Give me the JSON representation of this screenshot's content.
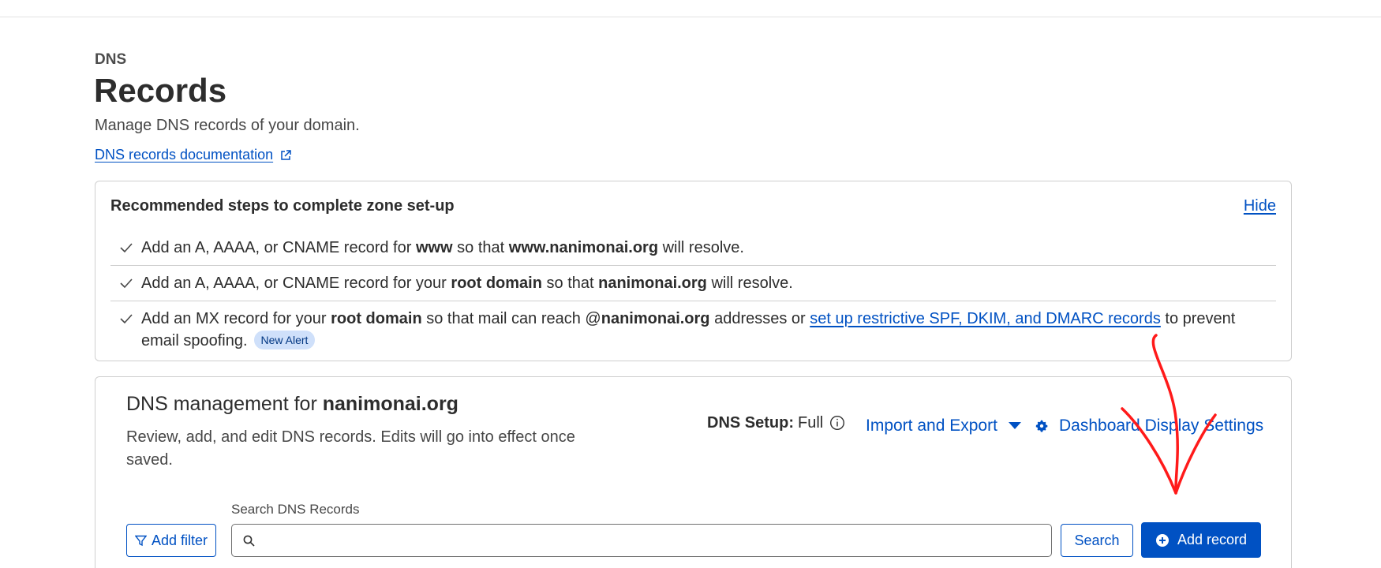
{
  "header": {
    "eyebrow": "DNS",
    "title": "Records",
    "description": "Manage DNS records of your domain.",
    "documentation_link": "DNS records documentation"
  },
  "recommended_steps": {
    "title": "Recommended steps to complete zone set-up",
    "hide_label": "Hide",
    "steps": [
      {
        "text_1": "Add an A, AAAA, or CNAME record for ",
        "bold_1": "www",
        "text_2": " so that ",
        "bold_2": "www.nanimonai.org",
        "text_3": " will resolve."
      },
      {
        "text_1": "Add an A, AAAA, or CNAME record for your ",
        "bold_1": "root domain",
        "text_2": " so that ",
        "bold_2": "nanimonai.org",
        "text_3": " will resolve."
      },
      {
        "text_1": "Add an MX record for your ",
        "bold_1": "root domain",
        "text_2": " so that mail can reach @",
        "bold_2": "nanimonai.org",
        "text_3": " addresses or ",
        "link": "set up restrictive SPF, DKIM, and DMARC records",
        "text_4": " to prevent email spoofing.",
        "badge": "New Alert"
      }
    ]
  },
  "management": {
    "title_prefix": "DNS management for ",
    "domain": "nanimonai.org",
    "description": "Review, add, and edit DNS records. Edits will go into effect once saved.",
    "setup_label": "DNS Setup:",
    "setup_value": "Full",
    "import_export_label": "Import and Export",
    "display_settings_label": "Dashboard Display Settings",
    "search_label": "Search DNS Records",
    "search_value": "",
    "search_placeholder": "",
    "add_filter_label": "Add filter",
    "search_button_label": "Search",
    "add_record_label": "Add record"
  },
  "icons": {
    "check": "check-icon",
    "external_link": "external-link-icon",
    "info": "info-circle-icon",
    "caret": "caret-down-icon",
    "gear": "gear-icon",
    "filter": "filter-icon",
    "search": "search-icon",
    "add": "plus-circle-icon",
    "annotation": "red-arrow-annotation"
  },
  "colors": {
    "primary": "#0051c3",
    "text": "#313131",
    "border": "#cfcfcf",
    "badge_bg": "#cfe0fa",
    "annotation": "#ff1a1a"
  }
}
